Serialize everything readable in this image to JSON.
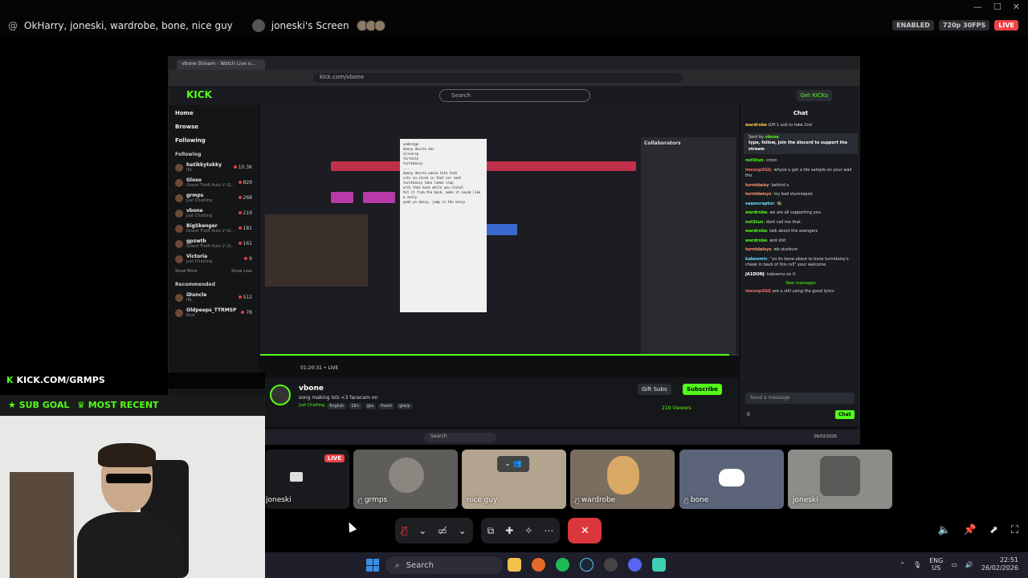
{
  "window": {
    "controls": [
      "—",
      "☐",
      "✕"
    ]
  },
  "call": {
    "title": "OkHarry, joneski, wardrobe, bone, nice guy",
    "screen_label": "joneski's Screen",
    "badge_enabled": "ENABLED",
    "badge_quality": "720p 30FPS",
    "badge_live": "LIVE"
  },
  "browser": {
    "tab_title": "vbone Stream - Watch Live o...",
    "url": "kick.com/vbone"
  },
  "kick": {
    "logo": "KICK",
    "search_placeholder": "Search",
    "get_kicks": "Get KICKs",
    "nav": [
      "Home",
      "Browse",
      "Following"
    ],
    "following_header": "Following",
    "following": [
      {
        "name": "hatikkytokky",
        "sub": "IRL",
        "count": "10.3K"
      },
      {
        "name": "Gloso",
        "sub": "Grand Theft Auto V (G...",
        "count": "829"
      },
      {
        "name": "grmps",
        "sub": "Just Chatting",
        "count": "268"
      },
      {
        "name": "vbone",
        "sub": "Just Chatting",
        "count": "219"
      },
      {
        "name": "BigSkenger",
        "sub": "Grand Theft Auto V (G...",
        "count": "181"
      },
      {
        "name": "gpzwth",
        "sub": "Grand Theft Auto V (G...",
        "count": "161"
      },
      {
        "name": "Victoria",
        "sub": "Just Chatting",
        "count": "9"
      }
    ],
    "show_more": "Show More",
    "show_less": "Show Less",
    "recommended_header": "Recommended",
    "recommended": [
      {
        "name": "iDuncle",
        "sub": "IRL",
        "count": "512"
      },
      {
        "name": "Oldpeeps_TTRMSP",
        "sub": "Rust",
        "count": "78"
      }
    ],
    "stream_time": "01:20:31",
    "stream_live": "LIVE",
    "streamer": "vbone",
    "stream_title": "song making lolz <3 facecam on",
    "category": "Just Chatting",
    "tags": [
      "English",
      "18+",
      "gta",
      "fivem",
      "gtarp"
    ],
    "gift_subs": "Gift Subs",
    "subscribe": "Subscribe",
    "viewers": "219 Viewers",
    "progress": 0.98
  },
  "daw": {
    "notepad_lines": [
      "underage",
      "danny devito dns",
      "olivercp",
      "fortnite",
      "turntdaisy",
      "...",
      "danny devito wanna talk that",
      "cuts on stuck in that car seat",
      "turntdaisy take lemon slap",
      "arch that back while you clench",
      "hit it from the back, make it sound like a nessy",
      "yeah yo daisy, jump in the nessy"
    ],
    "collab_title": "Collaborators"
  },
  "chat": {
    "title": "Chat",
    "pinned_user": "wardrobe",
    "pinned_text": "Gift 1 sub to take 2nd",
    "sent_by": "Sent by",
    "sent_by_user": "vbone",
    "sent_text": "type, follow, join the discord to support the stream",
    "messages": [
      {
        "user": "notStun",
        "color": "#53fc18",
        "text": "cmon"
      },
      {
        "user": "imcoopSGG",
        "color": "#ff6b6b",
        "text": "whyve u got a tile sample on your wall tho"
      },
      {
        "user": "turntdaisy",
        "color": "#ff9966",
        "text": "behind u"
      },
      {
        "user": "turntdaisyz",
        "color": "#ff9966",
        "text": "my bad stunniepoo"
      },
      {
        "user": "saamxraptor",
        "color": "#66ddff",
        "text": "🧌"
      },
      {
        "user": "wardrobe",
        "color": "#53fc18",
        "text": "we are all supporting you"
      },
      {
        "user": "notStun",
        "color": "#53fc18",
        "text": "dont call me that."
      },
      {
        "user": "wardrobe",
        "color": "#53fc18",
        "text": "talk about the avengers"
      },
      {
        "user": "wardrobe",
        "color": "#53fc18",
        "text": "and shit"
      },
      {
        "user": "turntdaisyz",
        "color": "#ff9966",
        "text": "wb sturbum"
      },
      {
        "user": "kaboomtc",
        "color": "#66ddff",
        "text": "\"yo its bone about to bone turntdaisy's cheek in back of this rs3\" your welcome"
      },
      {
        "user": "JA1DONJ",
        "color": "#ffffff",
        "text": "kaboomz on it"
      }
    ],
    "new_messages": "New messages",
    "last_message": {
      "user": "imcoopSGG",
      "color": "#ff6b6b",
      "text": "are u still using the good lyrics"
    },
    "input_placeholder": "Send a message",
    "kicks_count": "0",
    "send_label": "Chat"
  },
  "inner_taskbar": {
    "search": "Search",
    "clock_date": "26/02/2026"
  },
  "overlay": {
    "kick_url": "KICK.COM/GRMPS",
    "sub_goal": "SUB GOAL",
    "most_recent": "MOST RECENT"
  },
  "participants": [
    {
      "name": "joneski",
      "live": "LIVE"
    },
    {
      "name": "grmps"
    },
    {
      "name": "nice guy"
    },
    {
      "name": "wardrobe"
    },
    {
      "name": "bone"
    },
    {
      "name": "joneski"
    }
  ],
  "taskbar": {
    "search": "Search",
    "lang_top": "ENG",
    "lang_bottom": "US",
    "time": "22:51",
    "date": "26/02/2026"
  },
  "colors": {
    "kick_green": "#53fc18",
    "discord_red": "#da373c",
    "live_red": "#ed4245"
  }
}
